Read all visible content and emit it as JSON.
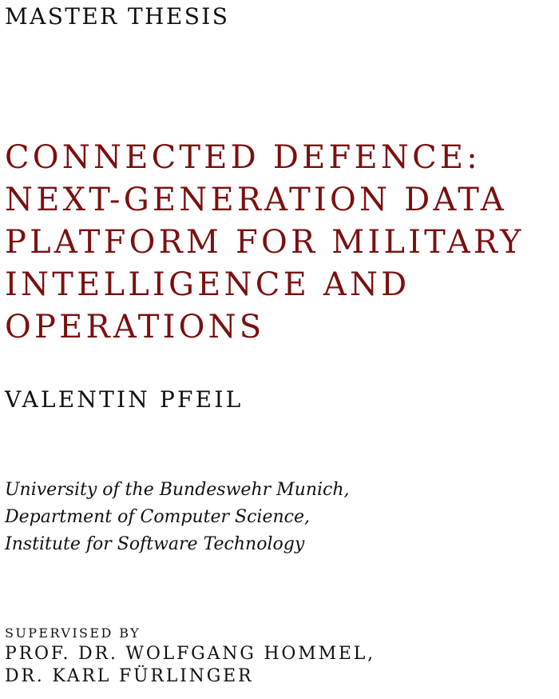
{
  "document_type": "MASTER THESIS",
  "title": {
    "lines": [
      "CONNECTED DEFENCE:",
      "NEXT-GENERATION DATA",
      "PLATFORM FOR MILITARY",
      "INTELLIGENCE AND",
      "OPERATIONS"
    ],
    "color": "#7a1010"
  },
  "author": "VALENTIN PFEIL",
  "affiliation": {
    "lines": [
      "University of the Bundeswehr Munich,",
      "Department of Computer Science,",
      "Institute for Software Technology"
    ]
  },
  "supervision": {
    "label": "SUPERVISED BY",
    "supervisors": [
      "PROF. DR. WOLFGANG HOMMEL,",
      "DR. KARL FÜRLINGER"
    ]
  }
}
